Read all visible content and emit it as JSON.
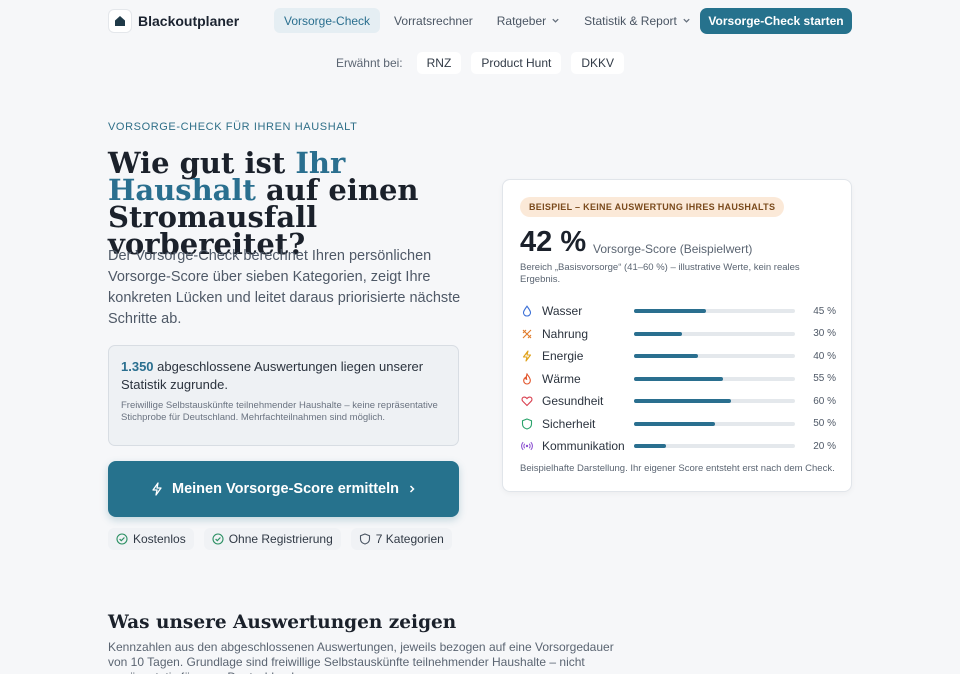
{
  "header": {
    "brand": "Blackoutplaner",
    "nav": [
      {
        "label": "Vorsorge-Check",
        "active": true,
        "dropdown": false
      },
      {
        "label": "Vorratsrechner",
        "active": false,
        "dropdown": false
      },
      {
        "label": "Ratgeber",
        "active": false,
        "dropdown": true
      },
      {
        "label": "Statistik & Report",
        "active": false,
        "dropdown": true
      }
    ],
    "cta_label": "Vorsorge-Check starten"
  },
  "mentioned": {
    "label": "Erwähnt bei:",
    "items": [
      "RNZ",
      "Product Hunt",
      "DKKV"
    ]
  },
  "hero": {
    "eyebrow": "Vorsorge-Check für Ihren Haushalt",
    "title_pre": "Wie gut ist ",
    "title_accent": "Ihr Haushalt",
    "title_post": " auf einen Stromausfall vorbereitet?",
    "subtitle": "Der Vorsorge-Check berechnet Ihren persönlichen Vorsorge-Score über sieben Kategorien, zeigt Ihre konkreten Lücken und leitet daraus priorisierte nächste Schritte ab.",
    "stat_number": "1.350",
    "stat_text": " abgeschlossene Auswertungen liegen unserer Statistik zugrunde.",
    "stat_note": "Freiwillige Selbstauskünfte teilnehmender Haushalte – keine repräsentative Stichprobe für Deutschland. Mehrfachteilnahmen sind möglich.",
    "cta_label": "Meinen Vorsorge-Score ermitteln",
    "badges": [
      {
        "label": "Kostenlos",
        "icon": "check-circle-icon"
      },
      {
        "label": "Ohne Registrierung",
        "icon": "check-circle-icon"
      },
      {
        "label": "7 Kategorien",
        "icon": "shield-icon"
      }
    ]
  },
  "score_card": {
    "pill": "BEISPIEL – KEINE AUSWERTUNG IHRES HAUSHALTS",
    "score": "42 %",
    "score_caption": "Vorsorge-Score (Beispielwert)",
    "range_text": "Bereich „Basisvorsorge“ (41–60 %) – illustrative Werte, kein reales Ergebnis.",
    "categories": [
      {
        "label": "Wasser",
        "value": 45,
        "pct": "45 %",
        "icon": "water-drop-icon",
        "color": "#3b6fd6"
      },
      {
        "label": "Nahrung",
        "value": 30,
        "pct": "30 %",
        "icon": "utensils-icon",
        "color": "#e07b2a"
      },
      {
        "label": "Energie",
        "value": 40,
        "pct": "40 %",
        "icon": "lightning-icon",
        "color": "#e0a21a"
      },
      {
        "label": "Wärme",
        "value": 55,
        "pct": "55 %",
        "icon": "flame-icon",
        "color": "#e2552b"
      },
      {
        "label": "Gesundheit",
        "value": 60,
        "pct": "60 %",
        "icon": "heart-icon",
        "color": "#d94050"
      },
      {
        "label": "Sicherheit",
        "value": 50,
        "pct": "50 %",
        "icon": "shield-icon",
        "color": "#2aa36b"
      },
      {
        "label": "Kommunikation",
        "value": 20,
        "pct": "20 %",
        "icon": "radio-waves-icon",
        "color": "#8a4fd0"
      }
    ],
    "footnote": "Beispielhafte Darstellung. Ihr eigener Score entsteht erst nach dem Check."
  },
  "results": {
    "title": "Was unsere Auswertungen zeigen",
    "text": "Kennzahlen aus den abgeschlossenen Auswertungen, jeweils bezogen auf eine Vorsorgedauer von 10 Tagen. Grundlage sind freiwillige Selbstauskünfte teilnehmender Haushalte – nicht repräsentativ für ganz Deutschland."
  },
  "colors": {
    "accent": "#2a6f8f",
    "cta": "#26728d",
    "pill_bg": "#fbe9d8"
  }
}
